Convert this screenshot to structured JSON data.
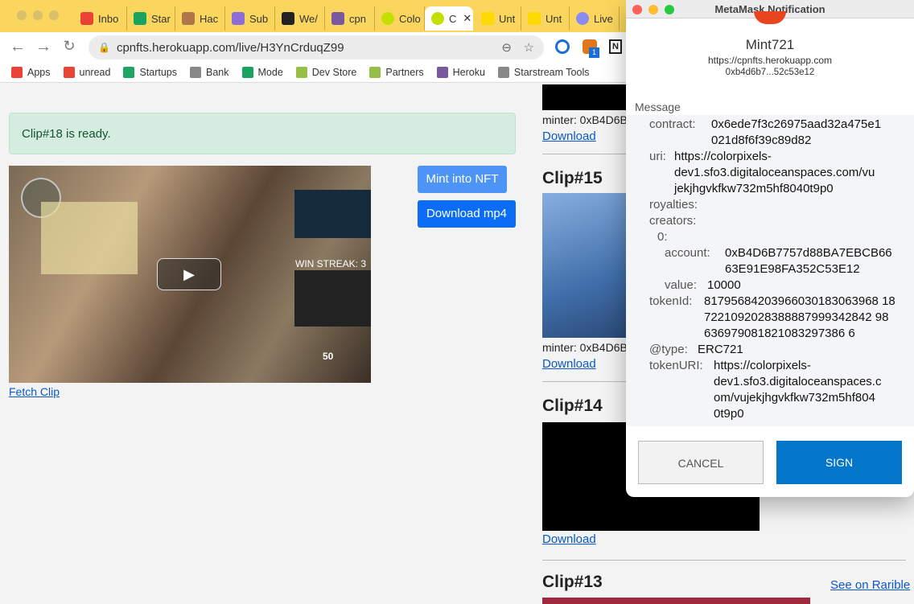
{
  "browser": {
    "tabs": [
      {
        "label": "Inbo",
        "icon": "gmail-icon",
        "color": "#ea4335"
      },
      {
        "label": "Star",
        "icon": "m-icon",
        "color": "#1aa260"
      },
      {
        "label": "Hac",
        "icon": "avatar-icon",
        "color": "#b0764a"
      },
      {
        "label": "Sub",
        "icon": "ethereum-icon",
        "color": "#8e6cd8"
      },
      {
        "label": "We/",
        "icon": "github-icon",
        "color": "#222222"
      },
      {
        "label": "cpn",
        "icon": "heroku-icon",
        "color": "#79589f"
      },
      {
        "label": "Colo",
        "icon": "colorpixels-icon",
        "color": "#c5e000"
      },
      {
        "label": "C",
        "icon": "colorpixels-icon",
        "color": "#c5e000",
        "active": true
      },
      {
        "label": "Unt",
        "icon": "rarible-icon",
        "color": "#feda03"
      },
      {
        "label": "Unt",
        "icon": "rarible-icon",
        "color": "#feda03"
      },
      {
        "label": "Live",
        "icon": "circle-icon",
        "color": "#8c8cf0"
      }
    ],
    "url": "cpnfts.herokuapp.com/live/H3YnCrduqZ99",
    "extension_badge": "1",
    "bookmarks": [
      {
        "label": "Apps",
        "icon": "apps-grid-icon",
        "color": "#ea4335"
      },
      {
        "label": "unread",
        "icon": "gmail-icon",
        "color": "#ea4335"
      },
      {
        "label": "Startups",
        "icon": "google-drive-icon",
        "color": "#1fa463"
      },
      {
        "label": "Bank",
        "icon": "folder-icon",
        "color": "#888888"
      },
      {
        "label": "Mode",
        "icon": "m-icon",
        "color": "#1aa260"
      },
      {
        "label": "Dev Store",
        "icon": "shopify-icon",
        "color": "#95bf47"
      },
      {
        "label": "Partners",
        "icon": "shopify-icon",
        "color": "#95bf47"
      },
      {
        "label": "Heroku",
        "icon": "heroku-icon",
        "color": "#79589f"
      },
      {
        "label": "Starstream Tools",
        "icon": "folder-icon",
        "color": "#888888"
      }
    ]
  },
  "page": {
    "alert": "Clip#18 is ready.",
    "mint_button": "Mint into NFT",
    "download_mp4_button": "Download mp4",
    "fetch_clip_link": "Fetch Clip",
    "video_hud": {
      "streak": "WIN STREAK: 3",
      "score": "50"
    },
    "clips": [
      {
        "minter": "minter: 0xB4D6B",
        "download": "Download"
      },
      {
        "title": "Clip#15",
        "minter": "minter: 0xB4D6B",
        "download": "Download"
      },
      {
        "title": "Clip#14",
        "download": "Download"
      },
      {
        "title": "Clip#13",
        "rarible": "See on Rarible"
      }
    ]
  },
  "metamask": {
    "window_title": "MetaMask Notification",
    "site_name": "Mint721",
    "origin": "https://cpnfts.herokuapp.com",
    "account": "0xb4d6b7...52c53e12",
    "message_label": "Message",
    "fields": {
      "contract_key": "contract:",
      "contract": [
        "0x6ede7f3c26975aad32a475e1",
        "021d8f6f39c89d82"
      ],
      "uri_key": "uri:",
      "uri": [
        "https://colorpixels-",
        "dev1.sfo3.digitaloceanspaces.com/vu",
        "jekjhgvkfkw732m5hf8040t9p0"
      ],
      "royalties_key": "royalties:",
      "creators_key": "creators:",
      "index_key": "0:",
      "account_key": "account:",
      "account": [
        "0xB4D6B7757d88BA7EBCB66",
        "63E91E98FA352C53E12"
      ],
      "value_key": "value:",
      "value": "10000",
      "tokenId_key": "tokenId:",
      "tokenId": [
        "81795684203966030183063968 18",
        "7221092028388887999342842 98",
        "636979081821083297386 6"
      ],
      "type_key": "@type:",
      "type": "ERC721",
      "tokenURI_key": "tokenURI:",
      "tokenURI": [
        "https://colorpixels-",
        "dev1.sfo3.digitaloceanspaces.c",
        "om/vujekjhgvkfkw732m5hf804",
        "0t9p0"
      ]
    },
    "cancel_button": "CANCEL",
    "sign_button": "SIGN",
    "colors": {
      "sign": "#0376c9",
      "cancel_bg": "#f2f2f2"
    }
  }
}
